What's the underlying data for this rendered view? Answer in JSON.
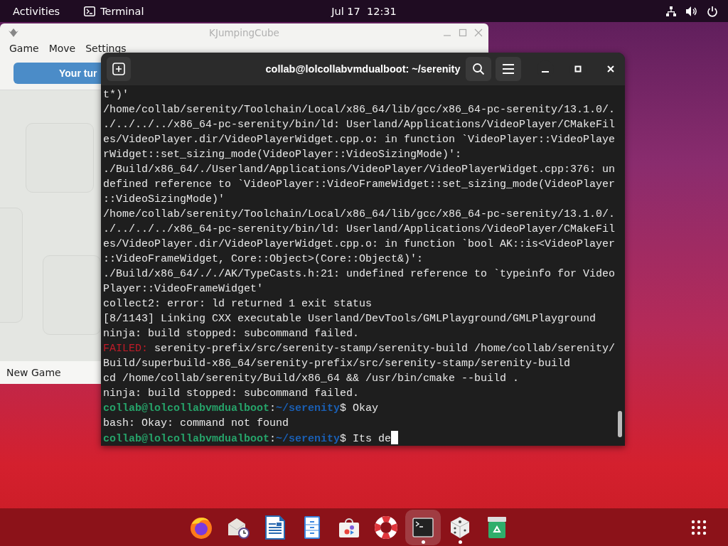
{
  "top_bar": {
    "activities": "Activities",
    "app_name": "Terminal",
    "clock": "Jul 17  12:31"
  },
  "game_window": {
    "title": "KJumpingCube",
    "menu": [
      "Game",
      "Move",
      "Settings"
    ],
    "turn_button": "Your tur",
    "status": "New Game"
  },
  "terminal": {
    "title": "collab@lolcollabvmdualboot: ~/serenity",
    "lines": [
      {
        "kind": "text",
        "text": "t*)'"
      },
      {
        "kind": "text",
        "text": "/home/collab/serenity/Toolchain/Local/x86_64/lib/gcc/x86_64-pc-serenity/13.1.0/."
      },
      {
        "kind": "text",
        "text": "./../../../x86_64-pc-serenity/bin/ld: Userland/Applications/VideoPlayer/CMakeFil"
      },
      {
        "kind": "text",
        "text": "es/VideoPlayer.dir/VideoPlayerWidget.cpp.o: in function `VideoPlayer::VideoPlaye"
      },
      {
        "kind": "text",
        "text": "rWidget::set_sizing_mode(VideoPlayer::VideoSizingMode)':"
      },
      {
        "kind": "text",
        "text": "./Build/x86_64/./Userland/Applications/VideoPlayer/VideoPlayerWidget.cpp:376: un"
      },
      {
        "kind": "text",
        "text": "defined reference to `VideoPlayer::VideoFrameWidget::set_sizing_mode(VideoPlayer"
      },
      {
        "kind": "text",
        "text": "::VideoSizingMode)'"
      },
      {
        "kind": "text",
        "text": "/home/collab/serenity/Toolchain/Local/x86_64/lib/gcc/x86_64-pc-serenity/13.1.0/."
      },
      {
        "kind": "text",
        "text": "./../../../x86_64-pc-serenity/bin/ld: Userland/Applications/VideoPlayer/CMakeFil"
      },
      {
        "kind": "text",
        "text": "es/VideoPlayer.dir/VideoPlayerWidget.cpp.o: in function `bool AK::is<VideoPlayer"
      },
      {
        "kind": "text",
        "text": "::VideoFrameWidget, Core::Object>(Core::Object&)':"
      },
      {
        "kind": "text",
        "text": "./Build/x86_64/././AK/TypeCasts.h:21: undefined reference to `typeinfo for Video"
      },
      {
        "kind": "text",
        "text": "Player::VideoFrameWidget'"
      },
      {
        "kind": "text",
        "text": "collect2: error: ld returned 1 exit status"
      },
      {
        "kind": "text",
        "text": "[8/1143] Linking CXX executable Userland/DevTools/GMLPlayground/GMLPlayground"
      },
      {
        "kind": "text",
        "text": "ninja: build stopped: subcommand failed."
      },
      {
        "kind": "error",
        "label": "FAILED:",
        "text": "serenity-prefix/src/serenity-stamp/serenity-build /home/collab/serenity/"
      },
      {
        "kind": "text",
        "text": "Build/superbuild-x86_64/serenity-prefix/src/serenity-stamp/serenity-build"
      },
      {
        "kind": "text",
        "text": "cd /home/collab/serenity/Build/x86_64 && /usr/bin/cmake --build ."
      },
      {
        "kind": "text",
        "text": "ninja: build stopped: subcommand failed."
      },
      {
        "kind": "prompt",
        "user": "collab@lolcollabvmdualboot",
        "separator": ":",
        "path": "~/serenity",
        "command": "$ Okay",
        "cursor": false
      },
      {
        "kind": "text",
        "text": "bash: Okay: command not found"
      },
      {
        "kind": "prompt",
        "user": "collab@lolcollabvmdualboot",
        "separator": ":",
        "path": "~/serenity",
        "command": "$ Its de",
        "cursor": true
      }
    ]
  },
  "dock": [
    {
      "kind": "firefox",
      "running": false,
      "selected": false
    },
    {
      "kind": "mail",
      "running": false,
      "selected": false
    },
    {
      "kind": "writer",
      "running": false,
      "selected": false
    },
    {
      "kind": "files",
      "running": false,
      "selected": false
    },
    {
      "kind": "store",
      "running": false,
      "selected": false
    },
    {
      "kind": "help",
      "running": false,
      "selected": false
    },
    {
      "kind": "terminal",
      "running": true,
      "selected": true
    },
    {
      "kind": "dice",
      "running": true,
      "selected": false
    },
    {
      "kind": "trash",
      "running": false,
      "selected": false
    },
    {
      "kind": "apps",
      "running": false,
      "selected": false
    }
  ]
}
